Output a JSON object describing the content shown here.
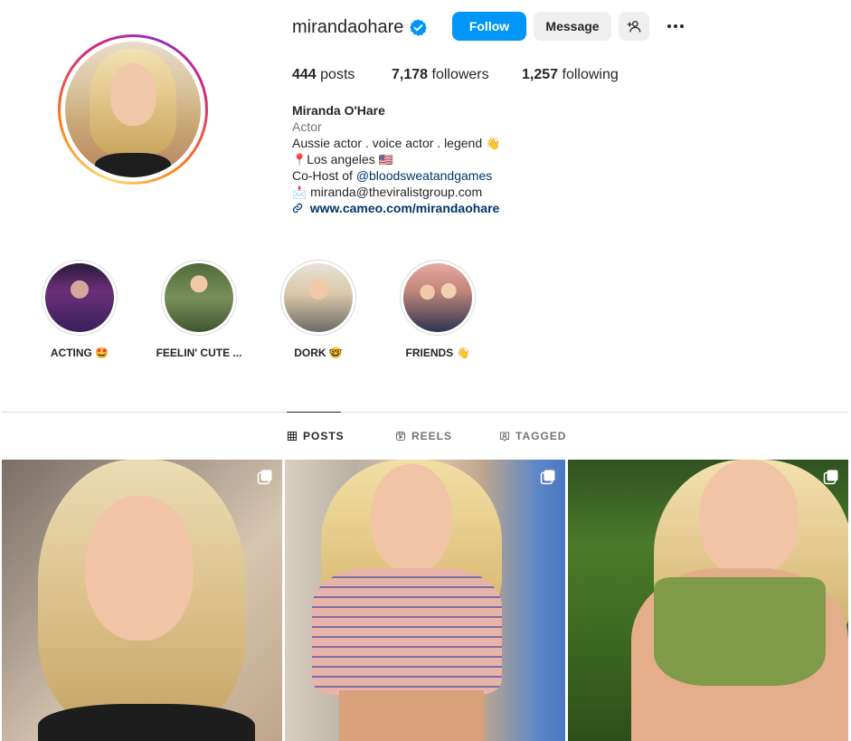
{
  "profile": {
    "username": "mirandaohare",
    "follow_label": "Follow",
    "message_label": "Message",
    "stats": {
      "posts_count": "444",
      "posts_label": "posts",
      "followers_count": "7,178",
      "followers_label": "followers",
      "following_count": "1,257",
      "following_label": "following"
    },
    "bio": {
      "name": "Miranda O'Hare",
      "category": "Actor",
      "line1": "Aussie actor . voice actor . legend",
      "line1_emoji": "👋",
      "line2_emoji": "📍",
      "line2": "Los angeles",
      "line2_flag": "🇺🇸",
      "line3_prefix": "Co-Host of ",
      "line3_mention": "@bloodsweatandgames",
      "line4_emoji": "📩",
      "line4": "miranda@theviralistgroup.com",
      "website_icon": "🔗",
      "website": "www.cameo.com/mirandaohare"
    }
  },
  "highlights": [
    {
      "label": "ACTING 🤩"
    },
    {
      "label": "FEELIN' CUTE ..."
    },
    {
      "label": "DORK 🤓"
    },
    {
      "label": "FRIENDS 👋"
    }
  ],
  "tabs": {
    "posts": "POSTS",
    "reels": "REELS",
    "tagged": "TAGGED"
  },
  "icons": {
    "verified": "verified-badge-icon",
    "add_user": "add-user-icon",
    "more": "more-options-icon",
    "posts_tab": "grid-icon",
    "reels_tab": "reels-icon",
    "tagged_tab": "tagged-icon",
    "multi_post": "carousel-icon"
  },
  "colors": {
    "accent": "#0095f6",
    "link": "#00376b",
    "muted": "#737373",
    "text": "#262626"
  }
}
